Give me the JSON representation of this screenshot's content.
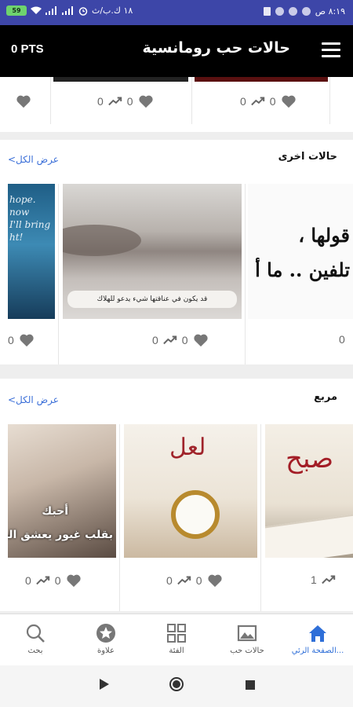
{
  "status_bar": {
    "time": "٨:١٩ ص",
    "network_speed": "١٨ ك.ب/ث",
    "battery": "59"
  },
  "app_bar": {
    "points": "0 PTS",
    "title": "حالات حب رومانسية",
    "menu_icon": "hamburger-menu-icon"
  },
  "top_row": {
    "cards": [
      {
        "likes": "0",
        "shares": "0"
      },
      {
        "likes": "0",
        "shares": "0"
      },
      {
        "likes": "",
        "shares": ""
      }
    ]
  },
  "sections": [
    {
      "title": "حالات اخرى",
      "view_all": "عرض الكل>",
      "items": [
        {
          "image": "text-image-arabic",
          "overlay_text": "قولها ،\nتلفين .. ما أ",
          "likes": "0",
          "shares": ""
        },
        {
          "image": "lips-photo-caption",
          "caption": "قد يكون في عناقتها شيء يدعو للهلاك",
          "likes": "0",
          "shares": "0"
        },
        {
          "image": "hope-quote-image",
          "overlay_text": "hope.\nnow\nI'll bring\nht!",
          "likes": "0",
          "shares": ""
        }
      ]
    },
    {
      "title": "مربع",
      "view_all": "عرض الكل>",
      "items": [
        {
          "image": "book-calligraphy",
          "overlay_text": "صبح",
          "likes": "",
          "shares": "1"
        },
        {
          "image": "pocket-watch-calligraphy",
          "overlay_text": "لعل",
          "likes": "0",
          "shares": "0"
        },
        {
          "image": "couple-photo-caption",
          "overlay_text": "أحبك\nبقلب غيور يعشق الت",
          "likes": "0",
          "shares": "0"
        }
      ]
    }
  ],
  "bottom_nav": [
    {
      "label": "الصفحة الرئي...",
      "icon": "home-icon",
      "active": true
    },
    {
      "label": "حالات حب",
      "icon": "image-icon",
      "active": false
    },
    {
      "label": "الفئة",
      "icon": "grid-icon",
      "active": false
    },
    {
      "label": "علاوة",
      "icon": "star-badge-icon",
      "active": false
    },
    {
      "label": "بحث",
      "icon": "search-icon",
      "active": false
    }
  ],
  "colors": {
    "status_bar": "#3d46a8",
    "app_bar": "#000000",
    "accent": "#2f6fd8",
    "link": "#3b6fd8"
  }
}
